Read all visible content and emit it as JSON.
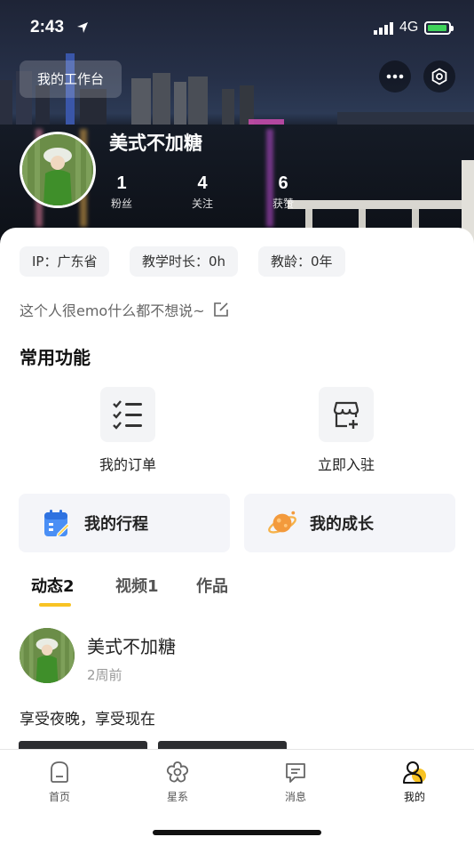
{
  "status_bar": {
    "time": "2:43",
    "network": "4G"
  },
  "header": {
    "workbench_label": "我的工作台",
    "more_icon": "more-dots-icon",
    "settings_icon": "settings-hexagon-icon"
  },
  "profile": {
    "name": "美式不加糖",
    "stats": [
      {
        "value": "1",
        "label": "粉丝"
      },
      {
        "value": "4",
        "label": "关注"
      },
      {
        "value": "6",
        "label": "获赞"
      }
    ],
    "chips": [
      "IP：广东省",
      "教学时长：0h",
      "教龄：0年"
    ],
    "bio": "这个人很emo什么都不想说~"
  },
  "functions": {
    "title": "常用功能",
    "items": [
      {
        "label": "我的订单",
        "icon": "checklist-icon"
      },
      {
        "label": "立即入驻",
        "icon": "store-add-icon"
      }
    ],
    "big_buttons": [
      {
        "label": "我的行程",
        "icon": "calendar-icon",
        "color": "#4a8ff5"
      },
      {
        "label": "我的成长",
        "icon": "planet-icon",
        "color": "#f39a3c"
      }
    ]
  },
  "content_tabs": [
    {
      "label": "动态2",
      "active": true
    },
    {
      "label": "视频1",
      "active": false
    },
    {
      "label": "作品",
      "active": false
    }
  ],
  "post": {
    "author": "美式不加糖",
    "time": "2周前",
    "text": "享受夜晚，享受现在"
  },
  "tabbar": {
    "items": [
      {
        "label": "首页",
        "icon": "home-icon"
      },
      {
        "label": "星系",
        "icon": "flower-icon"
      },
      {
        "label": "消息",
        "icon": "message-icon"
      },
      {
        "label": "我的",
        "icon": "profile-icon",
        "active": true
      }
    ]
  },
  "colors": {
    "accent_yellow": "#f8c323",
    "chip_bg": "#f3f4f6"
  }
}
